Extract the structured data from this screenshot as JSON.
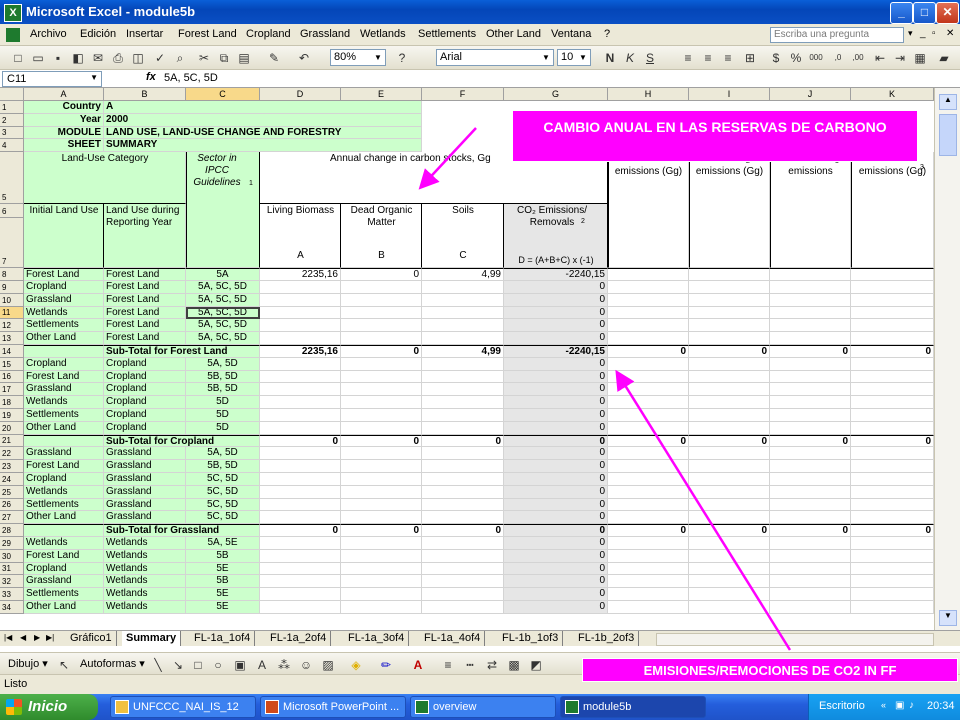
{
  "window": {
    "title": "Microsoft Excel - module5b",
    "min": "_",
    "max": "□",
    "close": "✕"
  },
  "menu": {
    "items": [
      "Archivo",
      "Edición",
      "Insertar",
      "Forest Land",
      "Cropland",
      "Grassland",
      "Wetlands",
      "Settlements",
      "Other Land",
      "Ventana",
      "?"
    ],
    "help_placeholder": "Escriba una pregunta"
  },
  "toolbar": {
    "zoom": "80%",
    "font": "Arial",
    "size": "10"
  },
  "formula": {
    "cell_ref": "C11",
    "fx": "fx",
    "value": "5A, 5C, 5D"
  },
  "columns": [
    "A",
    "B",
    "C",
    "D",
    "E",
    "F",
    "G",
    "H",
    "I",
    "J",
    "K"
  ],
  "info": [
    {
      "label": "Country",
      "value": "A"
    },
    {
      "label": "Year",
      "value": "2000"
    },
    {
      "label": "MODULE",
      "value": "LAND USE, LAND-USE CHANGE AND FORESTRY"
    },
    {
      "label": "SHEET",
      "value": "SUMMARY"
    }
  ],
  "headers": {
    "land_use_category": "Land-Use Category",
    "sector": "Sector in IPCC Guidelines",
    "sector_sup": "1",
    "annual_change": "Annual change in carbon stocks, Gg",
    "annual_sup": "2",
    "initial_land_use": "Initial Land Use",
    "land_use_during": "Land Use during Reporting Year",
    "living_biomass": "Living Biomass",
    "dom": "Dead Organic Matter",
    "soils": "Soils",
    "co2_emissions": "CO₂ Emissions/ Removals",
    "co2_sup": "2",
    "letter_a": "A",
    "letter_b": "B",
    "letter_c": "C",
    "formula_d": "D = (A+B+C) x (-1)",
    "emissions_h": "emissions (Gg)",
    "emissions_i": "emissions (Gg)",
    "emissions_j": "emissions",
    "emissions_k": "emissions (Gg)",
    "sup_i": "2",
    "sup_j": "3",
    "sup_k": "3"
  },
  "rows": [
    {
      "n": "8",
      "a": "Forest Land",
      "b": "Forest Land",
      "c": "5A",
      "d": "2235,16",
      "e": "0",
      "f": "4,99",
      "g": "-2240,15"
    },
    {
      "n": "9",
      "a": "Cropland",
      "b": "Forest Land",
      "c": "5A, 5C, 5D",
      "d": "",
      "e": "",
      "f": "",
      "g": "0"
    },
    {
      "n": "10",
      "a": "Grassland",
      "b": "Forest Land",
      "c": "5A, 5C, 5D",
      "d": "",
      "e": "",
      "f": "",
      "g": "0"
    },
    {
      "n": "11",
      "a": "Wetlands",
      "b": "Forest Land",
      "c": "5A, 5C, 5D",
      "d": "",
      "e": "",
      "f": "",
      "g": "0"
    },
    {
      "n": "12",
      "a": "Settlements",
      "b": "Forest Land",
      "c": "5A, 5C, 5D",
      "d": "",
      "e": "",
      "f": "",
      "g": "0"
    },
    {
      "n": "13",
      "a": "Other Land",
      "b": "Forest Land",
      "c": "5A, 5C, 5D",
      "d": "",
      "e": "",
      "f": "",
      "g": "0"
    },
    {
      "n": "14",
      "sub": "Sub-Total for Forest Land",
      "d": "2235,16",
      "e": "0",
      "f": "4,99",
      "g": "-2240,15",
      "h": "0",
      "i": "0",
      "j": "0",
      "k": "0"
    },
    {
      "n": "15",
      "a": "Cropland",
      "b": "Cropland",
      "c": "5A, 5D",
      "d": "",
      "e": "",
      "f": "",
      "g": "0"
    },
    {
      "n": "16",
      "a": "Forest Land",
      "b": "Cropland",
      "c": "5B, 5D",
      "d": "",
      "e": "",
      "f": "",
      "g": "0"
    },
    {
      "n": "17",
      "a": "Grassland",
      "b": "Cropland",
      "c": "5B, 5D",
      "d": "",
      "e": "",
      "f": "",
      "g": "0"
    },
    {
      "n": "18",
      "a": "Wetlands",
      "b": "Cropland",
      "c": "5D",
      "d": "",
      "e": "",
      "f": "",
      "g": "0"
    },
    {
      "n": "19",
      "a": "Settlements",
      "b": "Cropland",
      "c": "5D",
      "d": "",
      "e": "",
      "f": "",
      "g": "0"
    },
    {
      "n": "20",
      "a": "Other Land",
      "b": "Cropland",
      "c": "5D",
      "d": "",
      "e": "",
      "f": "",
      "g": "0"
    },
    {
      "n": "21",
      "sub": "Sub-Total for Cropland",
      "d": "0",
      "e": "0",
      "f": "0",
      "g": "0",
      "h": "0",
      "i": "0",
      "j": "0",
      "k": "0"
    },
    {
      "n": "22",
      "a": "Grassland",
      "b": "Grassland",
      "c": "5A, 5D",
      "d": "",
      "e": "",
      "f": "",
      "g": "0"
    },
    {
      "n": "23",
      "a": "Forest Land",
      "b": "Grassland",
      "c": "5B, 5D",
      "d": "",
      "e": "",
      "f": "",
      "g": "0"
    },
    {
      "n": "24",
      "a": "Cropland",
      "b": "Grassland",
      "c": "5C, 5D",
      "d": "",
      "e": "",
      "f": "",
      "g": "0"
    },
    {
      "n": "25",
      "a": "Wetlands",
      "b": "Grassland",
      "c": "5C, 5D",
      "d": "",
      "e": "",
      "f": "",
      "g": "0"
    },
    {
      "n": "26",
      "a": "Settlements",
      "b": "Grassland",
      "c": "5C, 5D",
      "d": "",
      "e": "",
      "f": "",
      "g": "0"
    },
    {
      "n": "27",
      "a": "Other Land",
      "b": "Grassland",
      "c": "5C, 5D",
      "d": "",
      "e": "",
      "f": "",
      "g": "0"
    },
    {
      "n": "28",
      "sub": "Sub-Total for Grassland",
      "d": "0",
      "e": "0",
      "f": "0",
      "g": "0",
      "h": "0",
      "i": "0",
      "j": "0",
      "k": "0"
    },
    {
      "n": "29",
      "a": "Wetlands",
      "b": "Wetlands",
      "c": "5A, 5E",
      "d": "",
      "e": "",
      "f": "",
      "g": "0"
    },
    {
      "n": "30",
      "a": "Forest Land",
      "b": "Wetlands",
      "c": "5B",
      "d": "",
      "e": "",
      "f": "",
      "g": "0"
    },
    {
      "n": "31",
      "a": "Cropland",
      "b": "Wetlands",
      "c": "5E",
      "d": "",
      "e": "",
      "f": "",
      "g": "0"
    },
    {
      "n": "32",
      "a": "Grassland",
      "b": "Wetlands",
      "c": "5B",
      "d": "",
      "e": "",
      "f": "",
      "g": "0"
    },
    {
      "n": "33",
      "a": "Settlements",
      "b": "Wetlands",
      "c": "5E",
      "d": "",
      "e": "",
      "f": "",
      "g": "0"
    },
    {
      "n": "34",
      "a": "Other Land",
      "b": "Wetlands",
      "c": "5E",
      "d": "",
      "e": "",
      "f": "",
      "g": "0"
    }
  ],
  "tabs": [
    "Gráfico1",
    "Summary",
    "FL-1a_1of4",
    "FL-1a_2of4",
    "FL-1a_3of4",
    "FL-1a_4of4",
    "FL-1b_1of3",
    "FL-1b_2of3"
  ],
  "drawbar": {
    "dibujo": "Dibujo ▾",
    "autoformas": "Autoformas ▾"
  },
  "status": "Listo",
  "taskbar": {
    "start": "Inicio",
    "items": [
      "UNFCCC_NAI_IS_12",
      "Microsoft PowerPoint ...",
      "overview",
      "module5b"
    ],
    "tray_label": "Escritorio",
    "clock": "20:34"
  },
  "annotations": {
    "top": "CAMBIO ANUAL EN LAS RESERVAS DE CARBONO",
    "bottom": "EMISIONES/REMOCIONES DE CO2 IN FF",
    "color": "#ff00ff"
  }
}
